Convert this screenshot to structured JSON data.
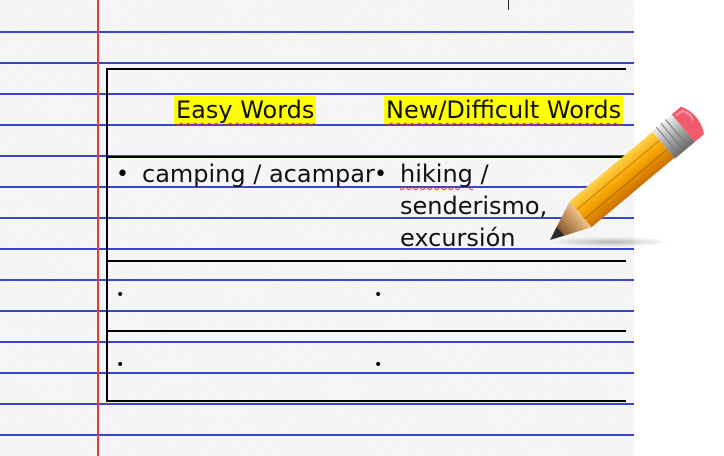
{
  "table": {
    "headers": {
      "easy": "Easy Words",
      "difficult": "New/Difficult Words"
    },
    "rows": [
      {
        "easy": "camping / acampar",
        "difficult_line1_word": "hiking",
        "difficult_line1_rest": " /",
        "difficult_line2": "senderismo,",
        "difficult_line3": "excursión"
      },
      {
        "easy": "",
        "difficult": ""
      },
      {
        "easy": "",
        "difficult": ""
      }
    ],
    "bullet_char": "•"
  },
  "colors": {
    "rule_line": "#3b46c9",
    "margin_line": "#e23b3b",
    "highlight": "#ffff00",
    "spellcheck": "#e03030"
  },
  "icons": {
    "pencil": "pencil-icon"
  }
}
